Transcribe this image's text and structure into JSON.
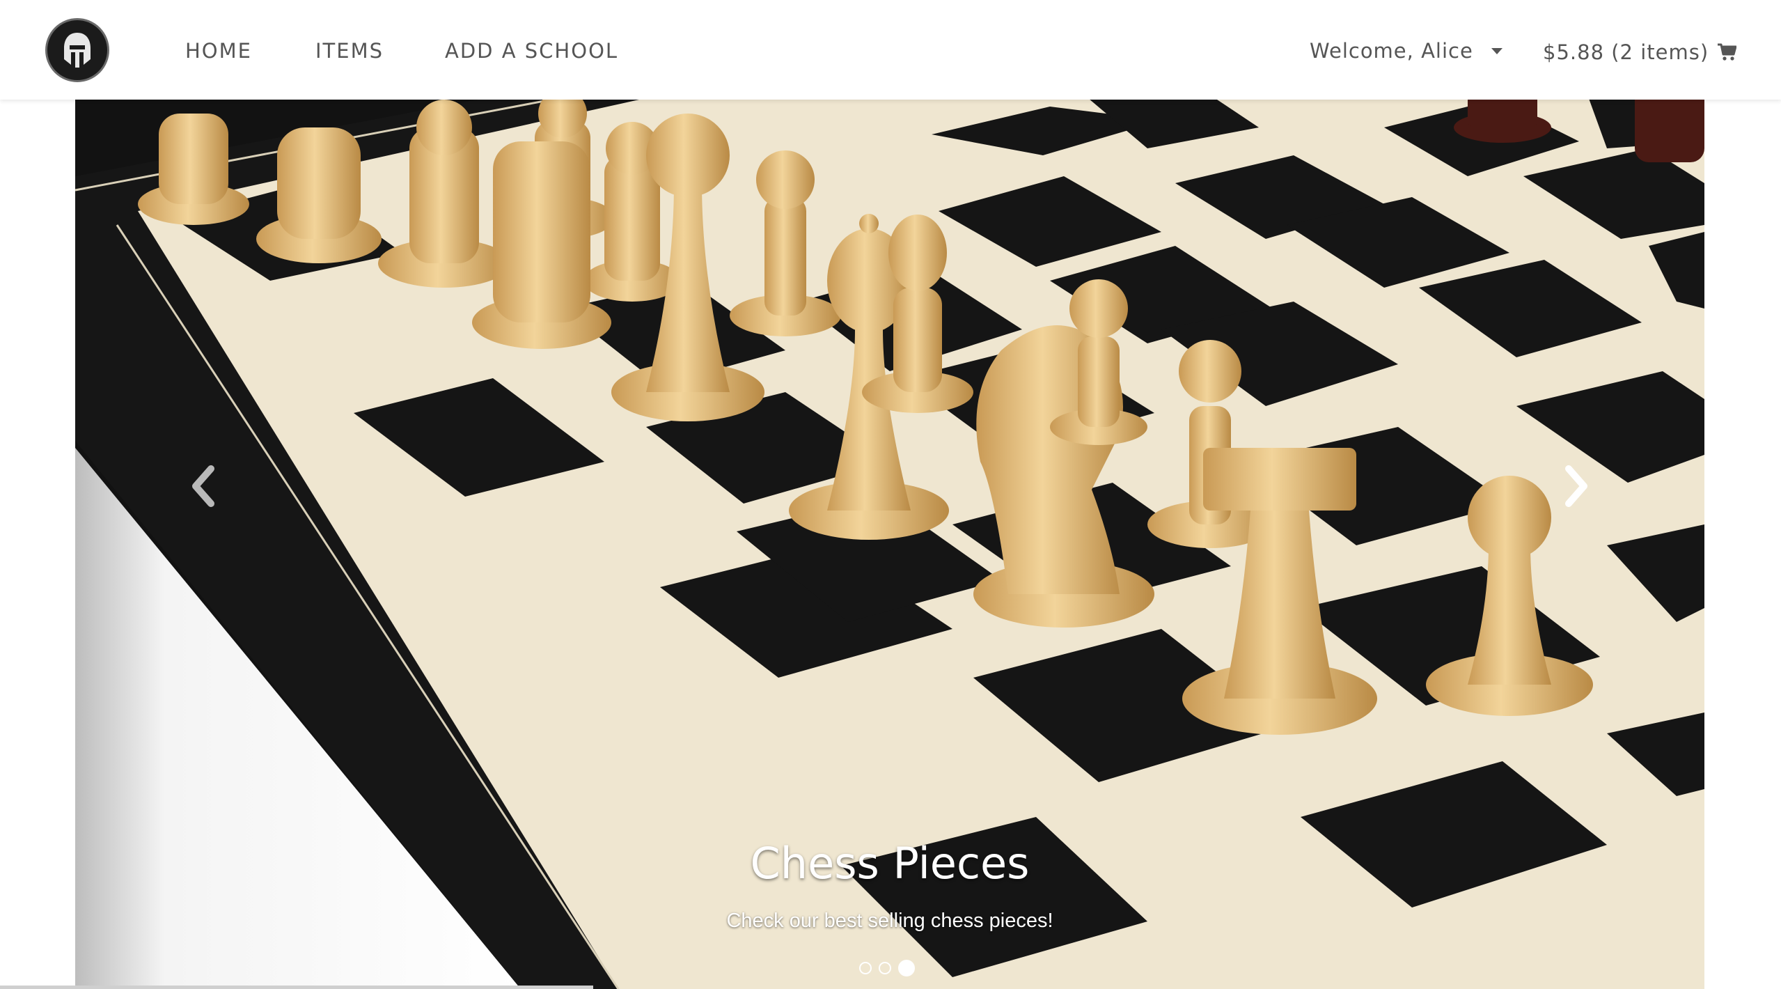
{
  "nav": {
    "home": "HOME",
    "items": "ITEMS",
    "add_school": "ADD A SCHOOL",
    "welcome": "Welcome, Alice",
    "cart": "$5.88 (2 items)"
  },
  "icons": {
    "logo": "spartan-helmet-logo",
    "caret": "caret-down-icon",
    "cart": "shopping-cart-icon",
    "prev": "chevron-left-icon",
    "next": "chevron-right-icon"
  },
  "carousel": {
    "title": "Chess Pieces",
    "subtitle": "Check our best selling chess pieces!",
    "slide_count": 3,
    "active_slide": 3
  },
  "colors": {
    "nav_text": "#555555",
    "board_dark": "#141414",
    "board_light": "#efe6d0",
    "piece_wood": "#e6bf7e"
  }
}
